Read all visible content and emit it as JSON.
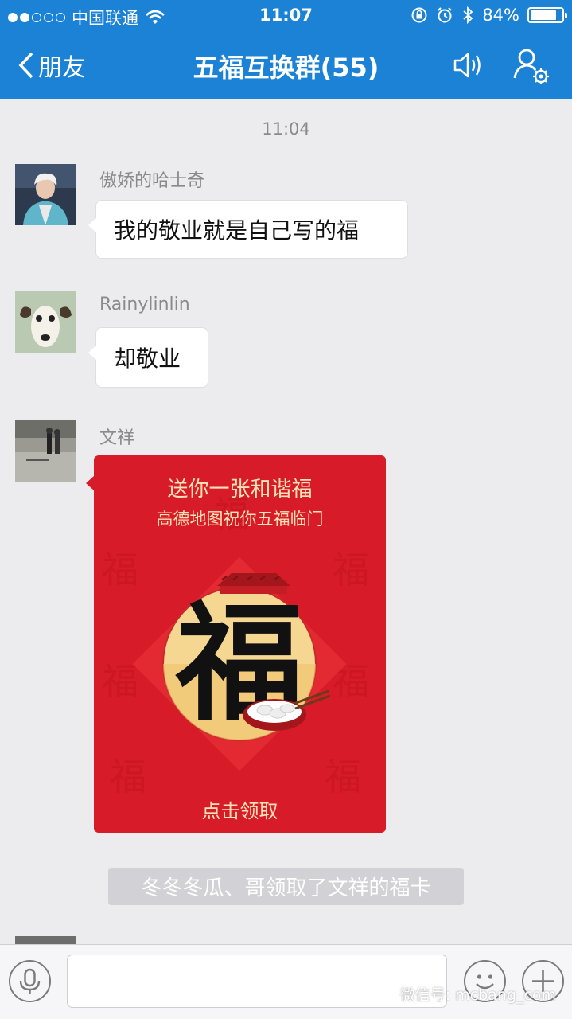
{
  "status_bar": {
    "carrier": "中国联通",
    "time": "11:07",
    "battery": "84%",
    "battery_level": 0.84,
    "icons": [
      "signal-dots-icon",
      "wifi-icon",
      "orientation-lock-icon",
      "alarm-icon",
      "bluetooth-icon",
      "battery-icon"
    ]
  },
  "nav": {
    "back_label": "朋友",
    "title": "五福互换群(55)",
    "icons": [
      "back-chevron-icon",
      "speaker-icon",
      "group-settings-icon"
    ]
  },
  "chat": {
    "timestamp": "11:04",
    "messages": [
      {
        "sender": "傲娇的哈士奇",
        "text": "我的敬业就是自己写的福"
      },
      {
        "sender": "Rainylinlin",
        "text": "却敬业"
      },
      {
        "sender": "文祥"
      }
    ],
    "card": {
      "title": "送你一张和谐福",
      "subtitle": "高德地图祝你五福临门",
      "glyph": "福",
      "action": "点击领取"
    },
    "system_note": "冬冬冬瓜、哥领取了文祥的福卡"
  },
  "input_bar": {
    "placeholder": "",
    "icons": [
      "voice-icon",
      "emoji-icon",
      "plus-icon"
    ]
  },
  "watermark": "微信号: mcbang_com",
  "colors": {
    "brand": "#1b82d6",
    "card_red": "#d71b28",
    "card_gold": "#ffe2b8"
  }
}
